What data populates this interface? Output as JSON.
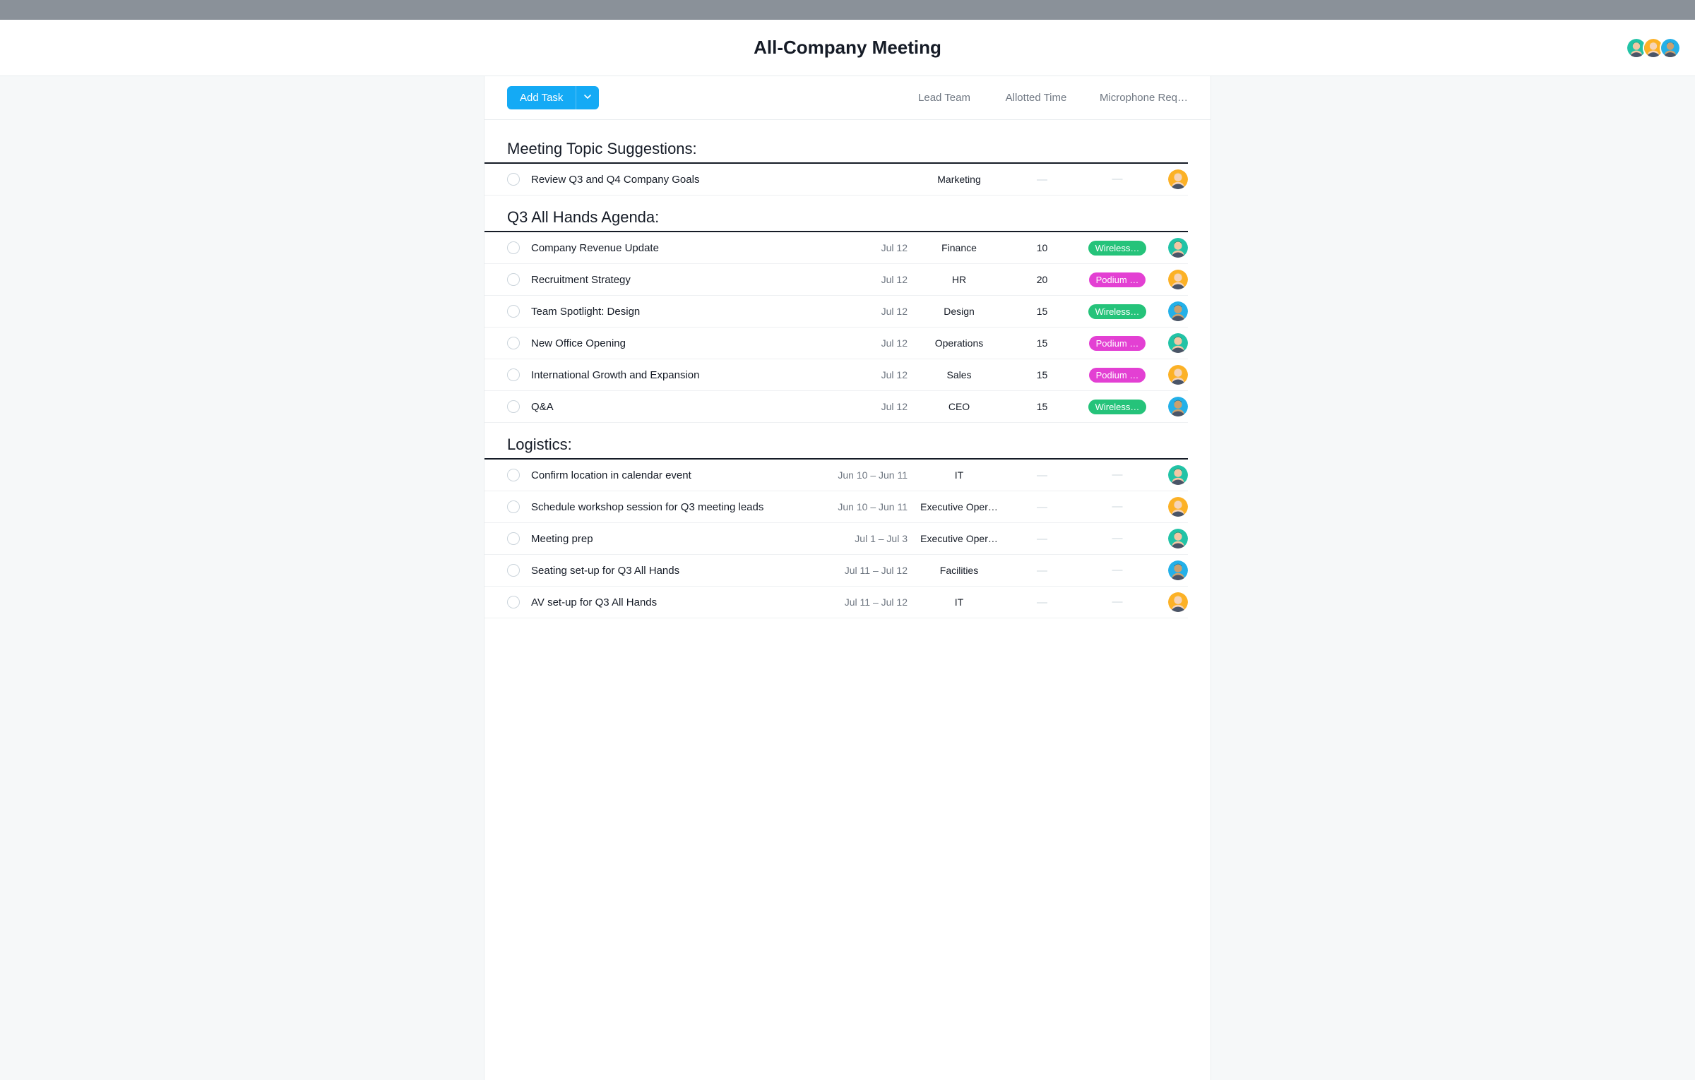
{
  "page_title": "All-Company Meeting",
  "toolbar": {
    "add_task_label": "Add Task"
  },
  "columns": {
    "lead": "Lead Team",
    "time": "Allotted Time",
    "mic": "Microphone Req…"
  },
  "avatars": {
    "teal": "#22c3a6",
    "yellow": "#fcb126",
    "blue": "#24b0e8"
  },
  "mic_labels": {
    "wireless": "Wireless…",
    "podium": "Podium …"
  },
  "sections": [
    {
      "title": "Meeting Topic Suggestions:",
      "tasks": [
        {
          "name": "Review Q3 and Q4 Company Goals",
          "date": "",
          "lead": "Marketing",
          "time": "",
          "mic": "",
          "assignee": "yellow"
        }
      ]
    },
    {
      "title": "Q3 All Hands Agenda:",
      "tasks": [
        {
          "name": "Company Revenue Update",
          "date": "Jul 12",
          "lead": "Finance",
          "time": "10",
          "mic": "wireless",
          "assignee": "teal"
        },
        {
          "name": "Recruitment Strategy",
          "date": "Jul 12",
          "lead": "HR",
          "time": "20",
          "mic": "podium",
          "assignee": "yellow"
        },
        {
          "name": "Team Spotlight: Design",
          "date": "Jul 12",
          "lead": "Design",
          "time": "15",
          "mic": "wireless",
          "assignee": "blue"
        },
        {
          "name": "New Office Opening",
          "date": "Jul 12",
          "lead": "Operations",
          "time": "15",
          "mic": "podium",
          "assignee": "teal"
        },
        {
          "name": "International Growth and Expansion",
          "date": "Jul 12",
          "lead": "Sales",
          "time": "15",
          "mic": "podium",
          "assignee": "yellow"
        },
        {
          "name": "Q&A",
          "date": "Jul 12",
          "lead": "CEO",
          "time": "15",
          "mic": "wireless",
          "assignee": "blue"
        }
      ]
    },
    {
      "title": "Logistics:",
      "tasks": [
        {
          "name": "Confirm location in calendar event",
          "date": "Jun 10 – Jun 11",
          "lead": "IT",
          "time": "",
          "mic": "",
          "assignee": "teal"
        },
        {
          "name": "Schedule workshop session for Q3 meeting leads",
          "date": "Jun 10 – Jun 11",
          "lead": "Executive Oper…",
          "time": "",
          "mic": "",
          "assignee": "yellow"
        },
        {
          "name": "Meeting prep",
          "date": "Jul 1 – Jul 3",
          "lead": "Executive Oper…",
          "time": "",
          "mic": "",
          "assignee": "teal"
        },
        {
          "name": "Seating set-up for Q3 All Hands",
          "date": "Jul 11 – Jul 12",
          "lead": "Facilities",
          "time": "",
          "mic": "",
          "assignee": "blue"
        },
        {
          "name": "AV set-up for Q3 All Hands",
          "date": "Jul 11 – Jul 12",
          "lead": "IT",
          "time": "",
          "mic": "",
          "assignee": "yellow"
        }
      ]
    }
  ]
}
